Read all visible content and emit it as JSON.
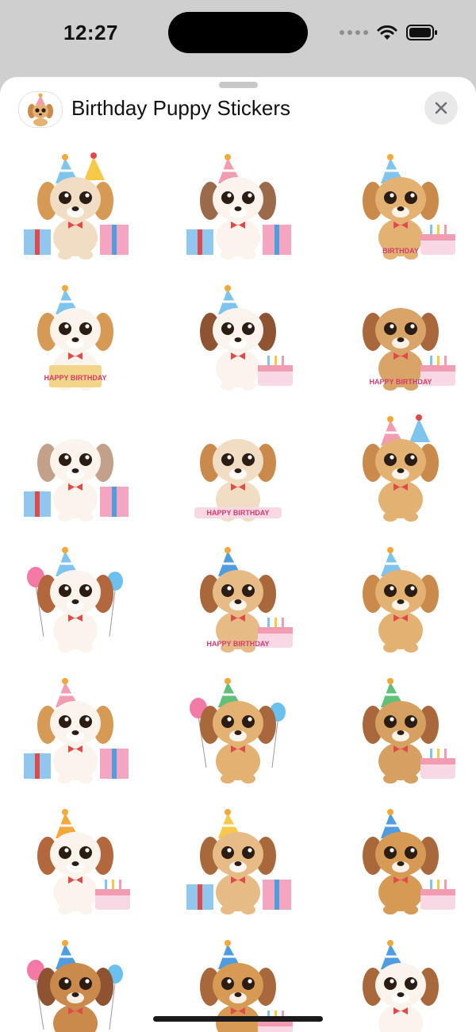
{
  "status_bar": {
    "time": "12:27",
    "icons": [
      "signal-dots-icon",
      "wifi-icon",
      "battery-icon"
    ]
  },
  "sheet": {
    "title": "Birthday Puppy Stickers",
    "app_icon": "puppy-app-icon",
    "close_icon": "close-icon"
  },
  "colors": {
    "accent_gifts": [
      "#8fc8ef",
      "#f4a6c0",
      "#f4a83a",
      "#e04a4a"
    ],
    "fur": [
      "#f1dcc4",
      "#d69a55",
      "#a8683c",
      "#fbf4ec"
    ]
  },
  "stickers": [
    {
      "id": 1,
      "fur": "#f1dcc4",
      "ear": "#d69a55",
      "hat": "#7fc4ee",
      "hat2": "#f7c948",
      "prop": "gifts",
      "caption": ""
    },
    {
      "id": 2,
      "fur": "#fbf4ec",
      "ear": "#9a6a4a",
      "hat": "#f29cb2",
      "hat2": "",
      "prop": "gifts",
      "caption": ""
    },
    {
      "id": 3,
      "fur": "#e3b272",
      "ear": "#c98a4b",
      "hat": "#7fc4ee",
      "hat2": "",
      "prop": "cake",
      "caption": "BIRTHDAY"
    },
    {
      "id": 4,
      "fur": "#fbf4ec",
      "ear": "#d69a55",
      "hat": "#7fc4ee",
      "hat2": "",
      "prop": "box",
      "caption": "HAPPY BIRTHDAY"
    },
    {
      "id": 5,
      "fur": "#fbf4ec",
      "ear": "#8e5331",
      "hat": "#7fc4ee",
      "hat2": "",
      "prop": "cake",
      "caption": ""
    },
    {
      "id": 6,
      "fur": "#d8a468",
      "ear": "#a8683c",
      "hat": "",
      "hat2": "",
      "prop": "cake",
      "caption": "HAPPY BIRTHDAY"
    },
    {
      "id": 7,
      "fur": "#fbf4ec",
      "ear": "#c2a08a",
      "hat": "",
      "hat2": "",
      "prop": "gifts",
      "caption": ""
    },
    {
      "id": 8,
      "fur": "#f1dcc4",
      "ear": "#c98a4b",
      "hat": "",
      "hat2": "",
      "prop": "banner",
      "caption": "HAPPY BIRTHDAY"
    },
    {
      "id": 9,
      "fur": "#e3b272",
      "ear": "#c98a4b",
      "hat": "#f29cb2",
      "hat2": "#7fc4ee",
      "prop": "none",
      "caption": ""
    },
    {
      "id": 10,
      "fur": "#fbf4ec",
      "ear": "#b2673d",
      "hat": "#7fc4ee",
      "hat2": "",
      "prop": "balloon",
      "caption": ""
    },
    {
      "id": 11,
      "fur": "#e7bb86",
      "ear": "#a8683c",
      "hat": "#4e9de0",
      "hat2": "",
      "prop": "cake",
      "caption": "HAPPY BIRTHDAY"
    },
    {
      "id": 12,
      "fur": "#e3b272",
      "ear": "#c98a4b",
      "hat": "#7fc4ee",
      "hat2": "",
      "prop": "none",
      "caption": ""
    },
    {
      "id": 13,
      "fur": "#fbf4ec",
      "ear": "#d69a55",
      "hat": "#f29cb2",
      "hat2": "",
      "prop": "gifts",
      "caption": ""
    },
    {
      "id": 14,
      "fur": "#e3b272",
      "ear": "#a8683c",
      "hat": "#5fc07a",
      "hat2": "",
      "prop": "balloon",
      "caption": ""
    },
    {
      "id": 15,
      "fur": "#d6a160",
      "ear": "#a8683c",
      "hat": "#5fc07a",
      "hat2": "",
      "prop": "cake",
      "caption": ""
    },
    {
      "id": 16,
      "fur": "#fbf4ec",
      "ear": "#b2673d",
      "hat": "#f4a83a",
      "hat2": "",
      "prop": "cake",
      "caption": ""
    },
    {
      "id": 17,
      "fur": "#e7bb86",
      "ear": "#a8683c",
      "hat": "#f7c948",
      "hat2": "",
      "prop": "gifts",
      "caption": ""
    },
    {
      "id": 18,
      "fur": "#d69a55",
      "ear": "#a8683c",
      "hat": "#4e9de0",
      "hat2": "",
      "prop": "cake",
      "caption": ""
    },
    {
      "id": 19,
      "fur": "#c98a4b",
      "ear": "#8e5331",
      "hat": "#4e9de0",
      "hat2": "",
      "prop": "balloon",
      "caption": ""
    },
    {
      "id": 20,
      "fur": "#d69a55",
      "ear": "#a8683c",
      "hat": "#4e9de0",
      "hat2": "",
      "prop": "cake",
      "caption": ""
    },
    {
      "id": 21,
      "fur": "#fbf4ec",
      "ear": "#a8683c",
      "hat": "#4e9de0",
      "hat2": "",
      "prop": "none",
      "caption": ""
    }
  ]
}
